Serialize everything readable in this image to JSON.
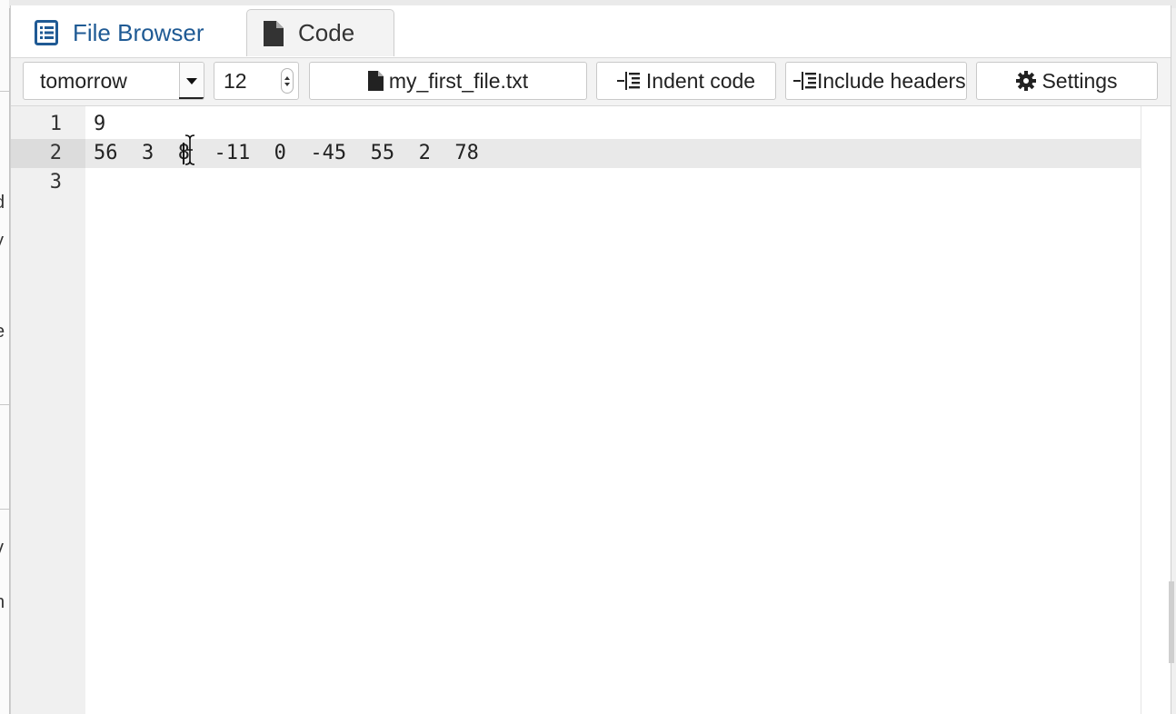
{
  "left_edge_fragments": [
    "l",
    "d",
    "y",
    "e",
    "v",
    "n"
  ],
  "tabs": [
    {
      "label": "File Browser",
      "icon": "list-icon",
      "active": false
    },
    {
      "label": "Code",
      "icon": "file-icon",
      "active": true
    }
  ],
  "toolbar": {
    "theme_value": "tomorrow",
    "font_size_value": "12",
    "file_label": "my_first_file.txt",
    "indent_label": "Indent code",
    "include_label": "Include headers",
    "settings_label": "Settings"
  },
  "editor": {
    "lines": [
      {
        "num": "1",
        "text": "9"
      },
      {
        "num": "2",
        "text": "56  3  8  -11  0  -45  55  2  78",
        "active": true
      },
      {
        "num": "3",
        "text": ""
      }
    ]
  },
  "colors": {
    "tab_text": "#1f5a94",
    "active_line": "#e9e9e9",
    "gutter": "#f0f0f0"
  }
}
